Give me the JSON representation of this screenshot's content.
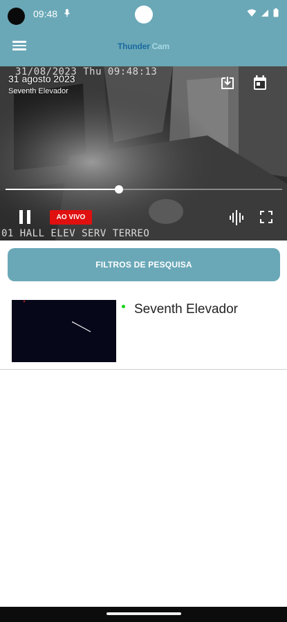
{
  "status_bar": {
    "time": "09:48"
  },
  "app_bar": {
    "brand_part1": "Thunder",
    "brand_part2": "Cam"
  },
  "player": {
    "osd_timestamp": "31/08/2023 Thu 09:48:13",
    "osd_camera": "01 HALL ELEV SERV TERREO",
    "date": "31 agosto 2023",
    "camera": "Seventh Elevador",
    "live_label": "AO VIVO",
    "progress": 0.41
  },
  "filters": {
    "label": "FILTROS DE PESQUISA"
  },
  "cameras": [
    {
      "name": "Seventh Elevador",
      "status_color": "#14d414"
    }
  ],
  "colors": {
    "primary": "#6aa8b7",
    "live": "#e01010"
  }
}
